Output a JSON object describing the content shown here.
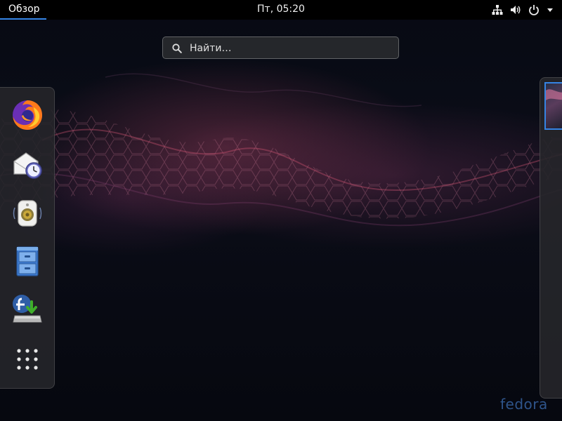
{
  "topbar": {
    "activities_label": "Обзор",
    "clock": "Пт, 05:20",
    "tray_icons": [
      "network-wired-icon",
      "volume-icon",
      "power-icon",
      "chevron-down-icon"
    ]
  },
  "search": {
    "placeholder": "Найти…",
    "value": ""
  },
  "dash": {
    "items": [
      {
        "name": "firefox",
        "icon": "firefox-icon"
      },
      {
        "name": "evolution",
        "icon": "mail-clock-icon"
      },
      {
        "name": "rhythmbox",
        "icon": "speaker-icon"
      },
      {
        "name": "files",
        "icon": "file-cabinet-icon"
      },
      {
        "name": "fedora-install",
        "icon": "fedora-install-icon"
      },
      {
        "name": "show-applications",
        "icon": "app-grid-icon"
      }
    ]
  },
  "branding": {
    "logo_text": "fedora"
  },
  "colors": {
    "accent": "#3584e4",
    "topbar": "#000000",
    "panel": "#26262a"
  }
}
